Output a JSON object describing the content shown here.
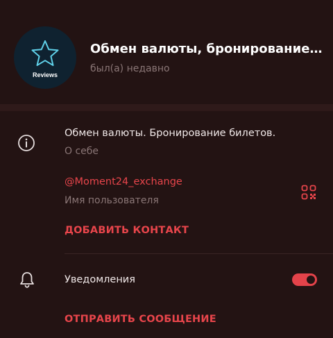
{
  "profile": {
    "avatar_label": "Reviews",
    "name": "Обмен валюты, бронирование билетов",
    "status": "был(а) недавно"
  },
  "info": {
    "bio": "Обмен валюты. Бронирование билетов.",
    "bio_caption": "О себе",
    "username": "@Moment24_exchange",
    "username_caption": "Имя пользователя"
  },
  "actions": {
    "add_contact": "ДОБАВИТЬ КОНТАКТ",
    "send_message": "ОТПРАВИТЬ СООБЩЕНИЕ"
  },
  "notifications": {
    "label": "Уведомления",
    "enabled": true
  },
  "colors": {
    "background": "#231313",
    "accent": "#e8454b",
    "avatar_bg": "#0f2230"
  },
  "icons": {
    "avatar": "star-icon",
    "info": "info-icon",
    "qr": "qr-code-icon",
    "notifications": "bell-icon"
  }
}
